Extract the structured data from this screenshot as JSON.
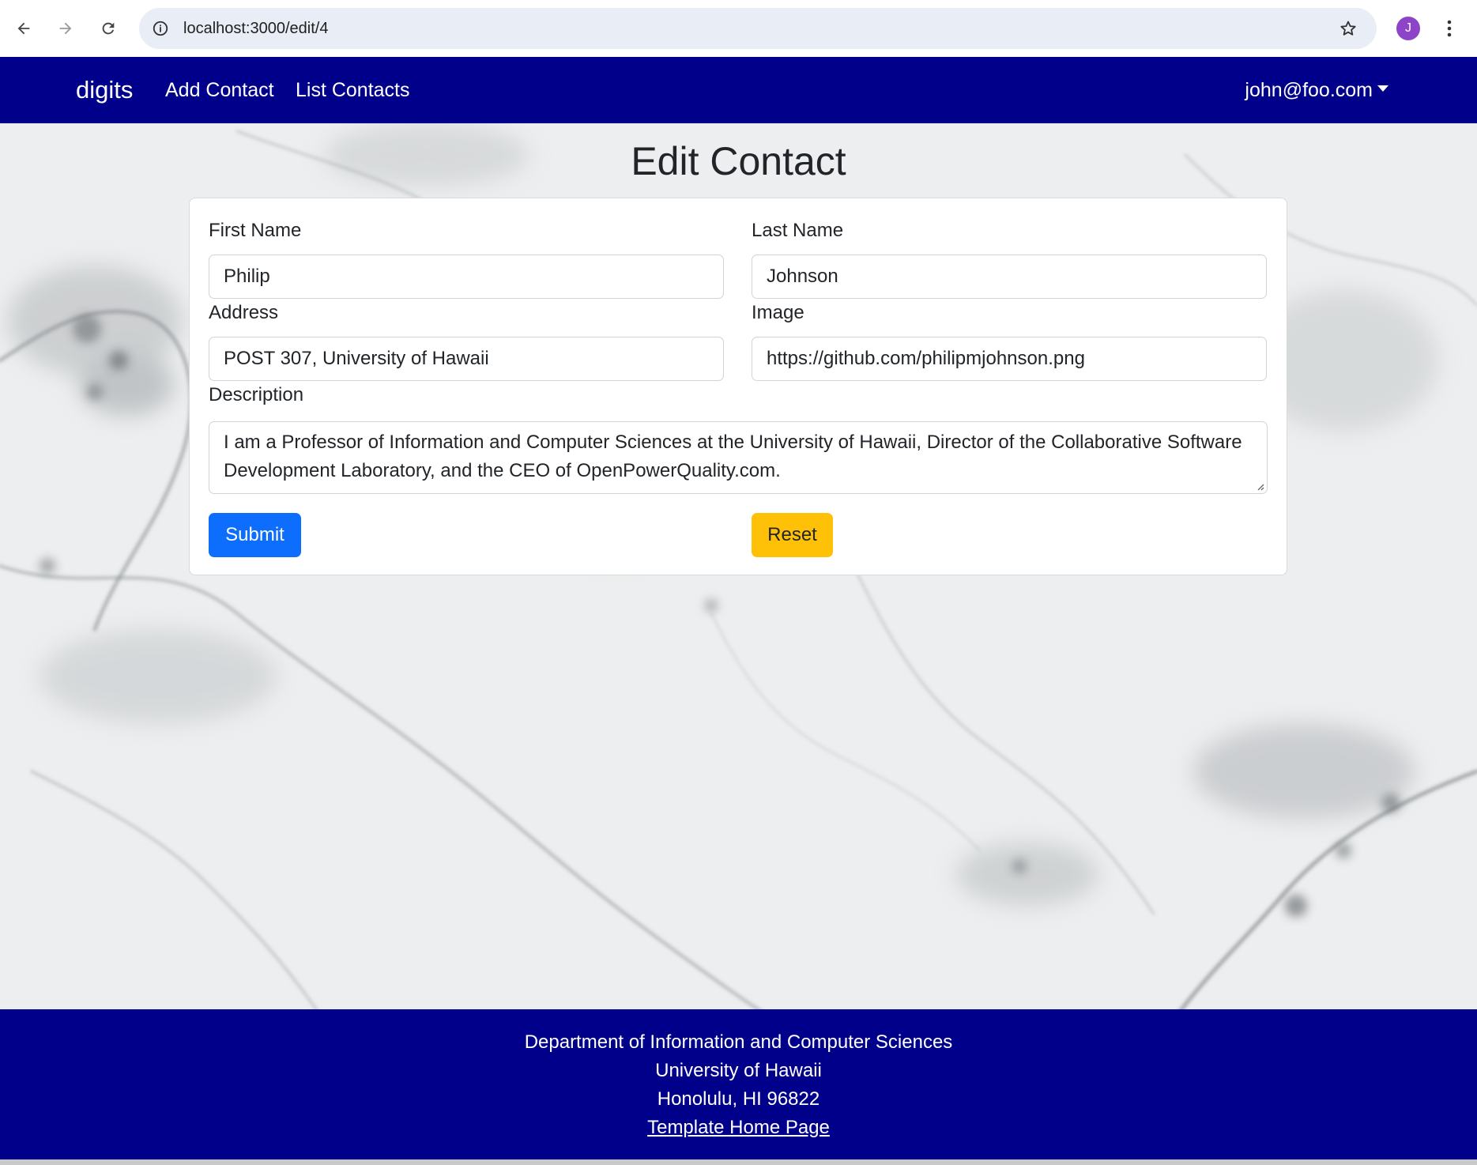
{
  "browser": {
    "url": "localhost:3000/edit/4",
    "profile_initial": "J",
    "back_icon": "arrow-left-icon",
    "forward_icon": "arrow-right-icon",
    "reload_icon": "reload-icon",
    "info_icon": "info-icon",
    "bookmark_icon": "star-icon",
    "menu_icon": "kebab-menu-icon"
  },
  "navbar": {
    "brand": "digits",
    "links": [
      "Add Contact",
      "List Contacts"
    ],
    "user": "john@foo.com",
    "bg_color": "#00008b"
  },
  "page": {
    "title": "Edit Contact"
  },
  "form": {
    "first_name": {
      "label": "First Name",
      "value": "Philip"
    },
    "last_name": {
      "label": "Last Name",
      "value": "Johnson"
    },
    "address": {
      "label": "Address",
      "value": "POST 307, University of Hawaii"
    },
    "image": {
      "label": "Image",
      "value": "https://github.com/philipmjohnson.png"
    },
    "description": {
      "label": "Description",
      "value": "I am a Professor of Information and Computer Sciences at the University of Hawaii, Director of the Collaborative Software Development Laboratory, and the CEO of OpenPowerQuality.com."
    },
    "submit_label": "Submit",
    "reset_label": "Reset",
    "submit_color": "#0d6efd",
    "reset_color": "#ffc107"
  },
  "footer": {
    "lines": [
      "Department of Information and Computer Sciences",
      "University of Hawaii",
      "Honolulu, HI 96822"
    ],
    "link": "Template Home Page"
  }
}
